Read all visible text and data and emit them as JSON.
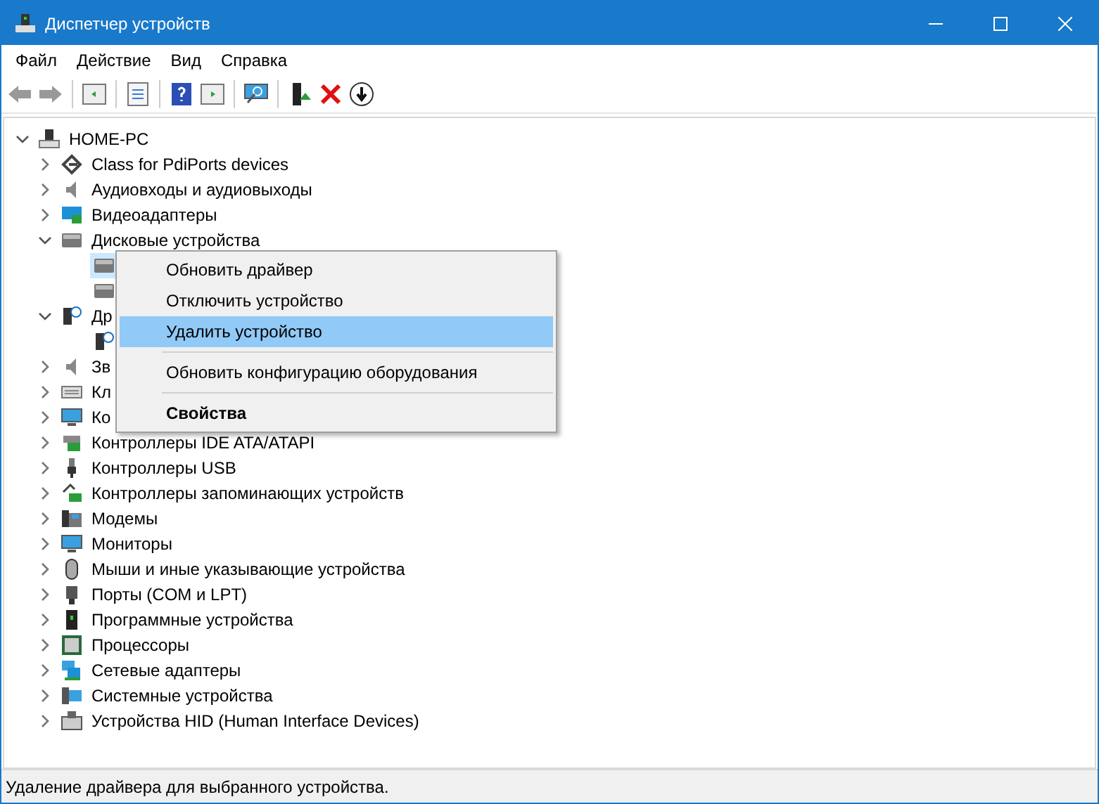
{
  "window": {
    "title": "Диспетчер устройств"
  },
  "menu": [
    "Файл",
    "Действие",
    "Вид",
    "Справка"
  ],
  "tree": {
    "label": "HOME-PC",
    "expanded": true,
    "children": [
      {
        "label": "Class for PdiPorts devices",
        "expanded": false
      },
      {
        "label": "Аудиовходы и аудиовыходы",
        "expanded": false
      },
      {
        "label": "Видеоадаптеры",
        "expanded": false
      },
      {
        "label": "Дисковые устройства",
        "expanded": true,
        "children": [
          {
            "selected": true
          },
          {
            "selected": false
          }
        ]
      },
      {
        "label": "Др",
        "expanded": true,
        "children": [
          {
            "selected": false
          }
        ]
      },
      {
        "label": "Зв",
        "expanded": false
      },
      {
        "label": "Кл",
        "expanded": false
      },
      {
        "label": "Ко",
        "expanded": false
      },
      {
        "label": "Контроллеры IDE ATA/ATAPI",
        "expanded": false
      },
      {
        "label": "Контроллеры USB",
        "expanded": false
      },
      {
        "label": "Контроллеры запоминающих устройств",
        "expanded": false
      },
      {
        "label": "Модемы",
        "expanded": false
      },
      {
        "label": "Мониторы",
        "expanded": false
      },
      {
        "label": "Мыши и иные указывающие устройства",
        "expanded": false
      },
      {
        "label": "Порты (COM и LPT)",
        "expanded": false
      },
      {
        "label": "Программные устройства",
        "expanded": false
      },
      {
        "label": "Процессоры",
        "expanded": false
      },
      {
        "label": "Сетевые адаптеры",
        "expanded": false
      },
      {
        "label": "Системные устройства",
        "expanded": false
      },
      {
        "label": "Устройства HID (Human Interface Devices)",
        "expanded": false
      }
    ]
  },
  "context_menu": [
    {
      "kind": "item",
      "label": "Обновить драйвер",
      "selected": false,
      "default": false
    },
    {
      "kind": "item",
      "label": "Отключить устройство",
      "selected": false,
      "default": false
    },
    {
      "kind": "item",
      "label": "Удалить устройство",
      "selected": true,
      "default": false
    },
    {
      "kind": "separator"
    },
    {
      "kind": "item",
      "label": "Обновить конфигурацию оборудования",
      "selected": false,
      "default": false
    },
    {
      "kind": "separator"
    },
    {
      "kind": "item",
      "label": "Свойства",
      "selected": false,
      "default": true
    }
  ],
  "status_bar": "Удаление драйвера для выбранного устройства."
}
